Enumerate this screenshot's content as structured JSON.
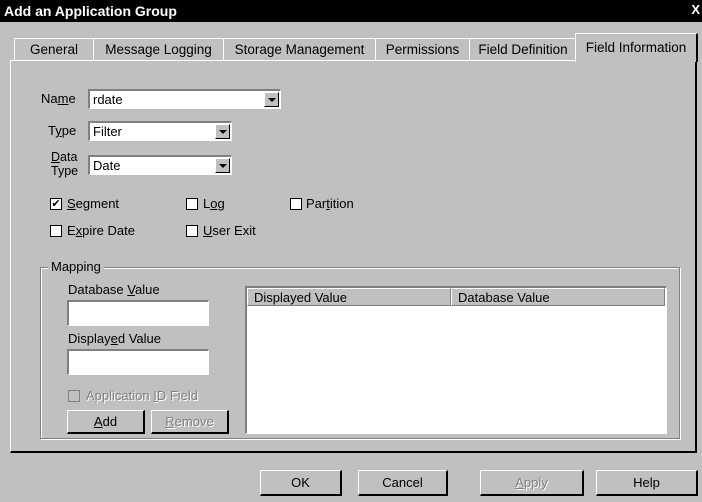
{
  "window": {
    "title": "Add an Application Group",
    "close_glyph": "X"
  },
  "tabs": [
    {
      "label": "General",
      "mnemonic": "",
      "active": false
    },
    {
      "label": "Message Logging",
      "active": false
    },
    {
      "label": "Storage Management",
      "active": false
    },
    {
      "label": "Permissions",
      "active": false
    },
    {
      "label": "Field Definition",
      "active": false
    },
    {
      "label": "Field Information",
      "active": true
    }
  ],
  "form": {
    "name_label_pre": "Na",
    "name_label_u": "m",
    "name_label_post": "e",
    "name_value": "rdate",
    "type_label_pre": "T",
    "type_label_u": "y",
    "type_label_post": "pe",
    "type_value": "Filter",
    "datatype_label_line1_u": "D",
    "datatype_label_line1_post": "ata",
    "datatype_label_line2": "Type",
    "datatype_value": "Date"
  },
  "checkboxes": {
    "segment": {
      "pre": "",
      "u": "S",
      "post": "egment",
      "checked": true,
      "mark": "✔"
    },
    "log": {
      "pre": "L",
      "u": "o",
      "post": "g",
      "checked": false
    },
    "partition": {
      "pre": "Par",
      "u": "t",
      "post": "ition",
      "checked": false
    },
    "expire_date": {
      "pre": "E",
      "u": "x",
      "post": "pire Date",
      "checked": false
    },
    "user_exit": {
      "pre": "",
      "u": "U",
      "post": "ser Exit",
      "checked": false
    }
  },
  "mapping": {
    "legend": "Mapping",
    "db_value_label_pre": "Database ",
    "db_value_label_u": "V",
    "db_value_label_post": "alue",
    "db_value": "",
    "disp_value_label_pre": "Display",
    "disp_value_label_u": "e",
    "disp_value_label_post": "d Value",
    "disp_value": "",
    "app_id_pre": "Application ",
    "app_id_u": "I",
    "app_id_post": "D Field",
    "add_u": "A",
    "add_post": "dd",
    "remove_u": "R",
    "remove_post": "emove",
    "columns": [
      "Displayed Value",
      "Database Value"
    ]
  },
  "footer": {
    "ok": "OK",
    "cancel": "Cancel",
    "apply_u": "A",
    "apply_post": "pply",
    "help": "Help"
  }
}
